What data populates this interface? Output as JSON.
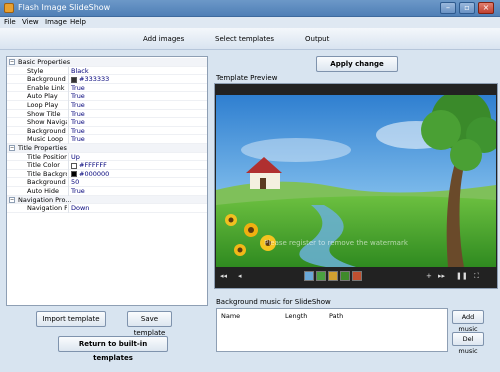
{
  "window": {
    "title": "Flash Image SlideShow",
    "controls": [
      "minimize-icon",
      "maximize-icon",
      "close-icon"
    ]
  },
  "menu": [
    "File",
    "View",
    "Image",
    "Help"
  ],
  "toolbar": {
    "add_images": "Add images",
    "select_templates": "Select templates",
    "output": "Output"
  },
  "properties": {
    "basic_title": "Basic Properties",
    "title_title": "Title Properties",
    "nav_title": "Navigation Pro...",
    "basic": [
      {
        "name": "Style",
        "value": "Black"
      },
      {
        "name": "Background C...",
        "value": "#333333",
        "swatch": "#333333"
      },
      {
        "name": "Enable Link",
        "value": "True"
      },
      {
        "name": "Auto Play",
        "value": "True"
      },
      {
        "name": "Loop Play",
        "value": "True"
      },
      {
        "name": "Show Title",
        "value": "True"
      },
      {
        "name": "Show Navigat...",
        "value": "True"
      },
      {
        "name": "Background ...",
        "value": "True"
      },
      {
        "name": "Music Loop",
        "value": "True"
      }
    ],
    "title": [
      {
        "name": "Title Position",
        "value": "Up"
      },
      {
        "name": "Title Color",
        "value": "#FFFFFF",
        "swatch": "#FFFFFF"
      },
      {
        "name": "Title Backgro...",
        "value": "#000000",
        "swatch": "#000000"
      },
      {
        "name": "Background A...",
        "value": "50"
      },
      {
        "name": "Auto Hide",
        "value": "True"
      }
    ],
    "nav": [
      {
        "name": "Navigation P...",
        "value": "Down"
      }
    ]
  },
  "buttons": {
    "apply_change": "Apply change",
    "import_template": "Import template",
    "save_template": "Save template",
    "return_builtin": "Return to built-in templates",
    "add_music": "Add music",
    "del_music": "Del music"
  },
  "preview": {
    "label": "Template Preview",
    "watermark": "Please register to remove the watermark"
  },
  "music": {
    "label": "Background music for SlideShow",
    "columns": [
      "Name",
      "Length",
      "Path"
    ]
  },
  "colors": {
    "accent": "#4f7fb6",
    "sky": "#3f8fd8",
    "grass": "#4aa030"
  }
}
